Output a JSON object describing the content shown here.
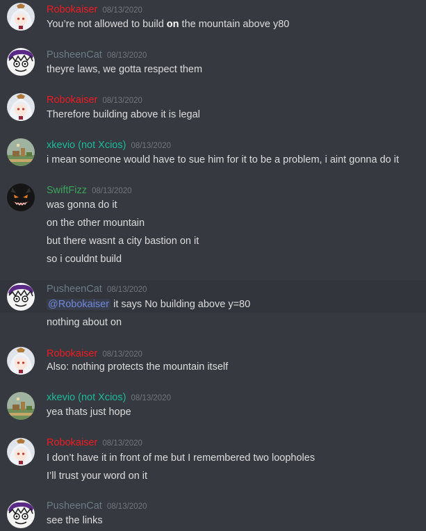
{
  "colors": {
    "background": "#36393f",
    "highlight_row": "#32353b",
    "timestamp": "#72767d",
    "text": "#dcddde",
    "mention": "#7289da"
  },
  "users": {
    "robokaiser": {
      "name": "Robokaiser",
      "color": "#ed1c24",
      "avatar_icon": "white-haired-anime-girl-avatar"
    },
    "pusheencat": {
      "name": "PusheenCat",
      "color": "#6b7c85",
      "avatar_icon": "scribble-face-avatar"
    },
    "xkevio": {
      "name": "xkevio (not Xcios)",
      "color": "#1abc9c",
      "avatar_icon": "pixel-landscape-avatar"
    },
    "swiftfizz": {
      "name": "SwiftFizz",
      "color": "#3ba55c",
      "avatar_icon": "black-demon-face-avatar"
    }
  },
  "messages": [
    {
      "user": "Robokaiser",
      "timestamp": "08/13/2020",
      "lines": [
        {
          "before": "You’re not allowed to build ",
          "bold": "on",
          "after": " the mountain above y80"
        }
      ]
    },
    {
      "user": "PusheenCat",
      "timestamp": "08/13/2020",
      "lines": [
        "theyre laws, we gotta respect them"
      ]
    },
    {
      "user": "Robokaiser",
      "timestamp": "08/13/2020",
      "lines": [
        "Therefore building above it is legal"
      ]
    },
    {
      "user": "xkevio (not Xcios)",
      "timestamp": "08/13/2020",
      "lines": [
        "i mean someone would have to sue him for it to be a problem, i aint gonna do it"
      ]
    },
    {
      "user": "SwiftFizz",
      "timestamp": "08/13/2020",
      "lines": [
        "was gonna do it",
        "on the other mountain",
        "but there wasnt a city bastion on it",
        "so i couldnt build"
      ]
    },
    {
      "user": "PusheenCat",
      "timestamp": "08/13/2020",
      "mention": "@Robokaiser",
      "lines": [
        " it says No building above y=80",
        "nothing about on"
      ]
    },
    {
      "user": "Robokaiser",
      "timestamp": "08/13/2020",
      "lines": [
        "Also: nothing protects the mountain itself"
      ]
    },
    {
      "user": "xkevio (not Xcios)",
      "timestamp": "08/13/2020",
      "lines": [
        "yea thats just hope"
      ]
    },
    {
      "user": "Robokaiser",
      "timestamp": "08/13/2020",
      "lines": [
        "I don’t have it in front of me but I remembered two loopholes",
        "I’ll trust your word on it"
      ]
    },
    {
      "user": "PusheenCat",
      "timestamp": "08/13/2020",
      "lines": [
        "see the links"
      ]
    }
  ]
}
